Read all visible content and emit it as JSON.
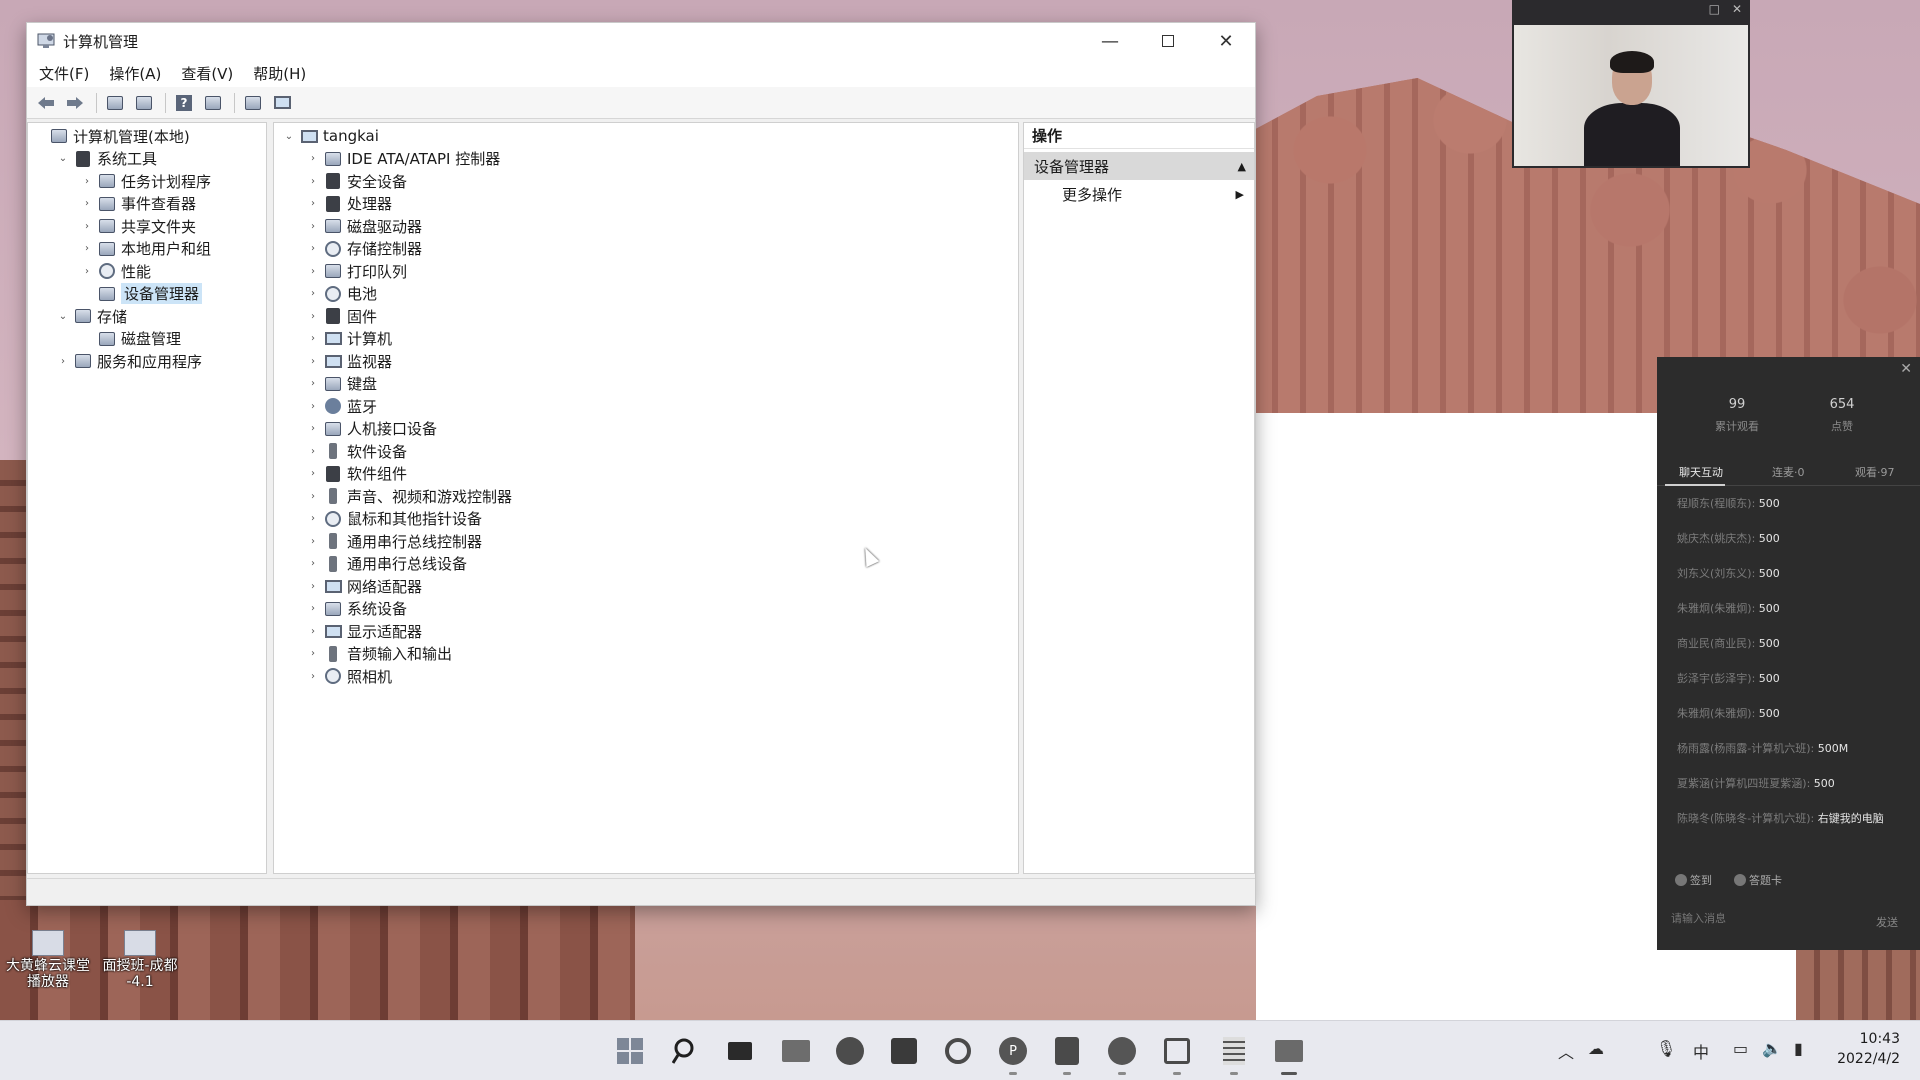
{
  "window": {
    "title": "计算机管理",
    "menu": [
      "文件(F)",
      "操作(A)",
      "查看(V)",
      "帮助(H)"
    ]
  },
  "nav_tree": [
    {
      "label": "计算机管理(本地)",
      "level": 0,
      "expander": "",
      "icon": "computer-management-icon"
    },
    {
      "label": "系统工具",
      "level": 1,
      "expander": "⌄",
      "icon": "system-tools-icon"
    },
    {
      "label": "任务计划程序",
      "level": 2,
      "expander": "›",
      "icon": "task-scheduler-icon"
    },
    {
      "label": "事件查看器",
      "level": 2,
      "expander": "›",
      "icon": "event-viewer-icon"
    },
    {
      "label": "共享文件夹",
      "level": 2,
      "expander": "›",
      "icon": "shared-folders-icon"
    },
    {
      "label": "本地用户和组",
      "level": 2,
      "expander": "›",
      "icon": "local-users-icon"
    },
    {
      "label": "性能",
      "level": 2,
      "expander": "›",
      "icon": "performance-icon"
    },
    {
      "label": "设备管理器",
      "level": 2,
      "expander": "",
      "icon": "device-manager-icon",
      "selected": true
    },
    {
      "label": "存储",
      "level": 1,
      "expander": "⌄",
      "icon": "storage-icon"
    },
    {
      "label": "磁盘管理",
      "level": 2,
      "expander": "",
      "icon": "disk-management-icon"
    },
    {
      "label": "服务和应用程序",
      "level": 1,
      "expander": "›",
      "icon": "services-apps-icon"
    }
  ],
  "device_tree": {
    "root": "tangkai",
    "categories": [
      {
        "label": "IDE ATA/ATAPI 控制器",
        "icon": "ide-controller-icon"
      },
      {
        "label": "安全设备",
        "icon": "security-device-icon"
      },
      {
        "label": "处理器",
        "icon": "processor-icon"
      },
      {
        "label": "磁盘驱动器",
        "icon": "disk-drive-icon"
      },
      {
        "label": "存储控制器",
        "icon": "storage-controller-icon"
      },
      {
        "label": "打印队列",
        "icon": "print-queue-icon"
      },
      {
        "label": "电池",
        "icon": "battery-icon"
      },
      {
        "label": "固件",
        "icon": "firmware-icon"
      },
      {
        "label": "计算机",
        "icon": "computer-icon"
      },
      {
        "label": "监视器",
        "icon": "monitor-icon"
      },
      {
        "label": "键盘",
        "icon": "keyboard-icon"
      },
      {
        "label": "蓝牙",
        "icon": "bluetooth-icon"
      },
      {
        "label": "人机接口设备",
        "icon": "hid-icon"
      },
      {
        "label": "软件设备",
        "icon": "software-device-icon"
      },
      {
        "label": "软件组件",
        "icon": "software-component-icon"
      },
      {
        "label": "声音、视频和游戏控制器",
        "icon": "sound-video-icon"
      },
      {
        "label": "鼠标和其他指针设备",
        "icon": "mouse-icon"
      },
      {
        "label": "通用串行总线控制器",
        "icon": "usb-controller-icon"
      },
      {
        "label": "通用串行总线设备",
        "icon": "usb-device-icon"
      },
      {
        "label": "网络适配器",
        "icon": "network-adapter-icon"
      },
      {
        "label": "系统设备",
        "icon": "system-device-icon"
      },
      {
        "label": "显示适配器",
        "icon": "display-adapter-icon"
      },
      {
        "label": "音频输入和输出",
        "icon": "audio-io-icon"
      },
      {
        "label": "照相机",
        "icon": "camera-icon"
      }
    ]
  },
  "actions": {
    "title": "操作",
    "section": "设备管理器",
    "more": "更多操作"
  },
  "desktop_icons": [
    {
      "label": "大黄蜂云课堂\n播放器"
    },
    {
      "label": "面授班-成都\n-4.1"
    }
  ],
  "chat": {
    "stats": [
      {
        "num": "99",
        "cap": "累计观看"
      },
      {
        "num": "654",
        "cap": "点赞"
      }
    ],
    "tabs": [
      "聊天互动",
      "连麦·0",
      "观看·97"
    ],
    "messages": [
      {
        "who": "程顺东(程顺东):",
        "text": "500"
      },
      {
        "who": "姚庆杰(姚庆杰):",
        "text": "500"
      },
      {
        "who": "刘东义(刘东义):",
        "text": "500"
      },
      {
        "who": "朱雅炯(朱雅炯):",
        "text": "500"
      },
      {
        "who": "商业民(商业民):",
        "text": "500"
      },
      {
        "who": "彭泽宇(彭泽宇):",
        "text": "500"
      },
      {
        "who": "朱雅炯(朱雅炯):",
        "text": "500"
      },
      {
        "who": "杨雨露(杨雨露-计算机六班):",
        "text": "500M"
      },
      {
        "who": "夏紫涵(计算机四班夏紫涵):",
        "text": "500"
      },
      {
        "who": "陈晓冬(陈晓冬-计算机六班):",
        "text": "右键我的电脑"
      }
    ],
    "actions": [
      "签到",
      "答题卡"
    ],
    "input_placeholder": "请输入消息",
    "send": "发送"
  },
  "tray": {
    "ime": "中",
    "time": "10:43",
    "date": "2022/4/2"
  }
}
